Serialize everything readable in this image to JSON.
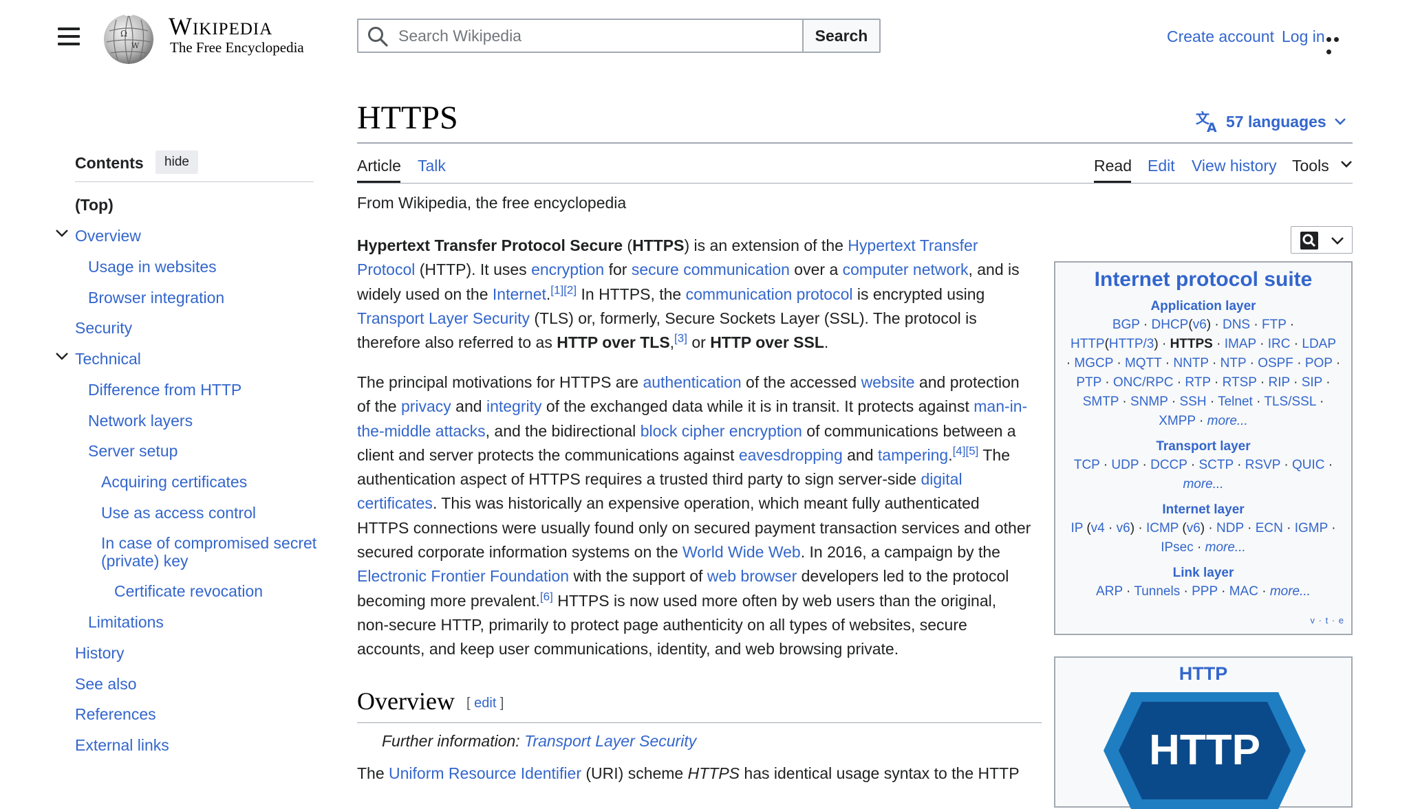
{
  "header": {
    "wordmark_title": "Wikipedia",
    "wordmark_tagline": "The Free Encyclopedia",
    "search_placeholder": "Search Wikipedia",
    "search_button": "Search",
    "create_account": "Create account",
    "log_in": "Log in"
  },
  "page": {
    "title": "HTTPS",
    "languages": "57 languages",
    "tabs_left": [
      "Article",
      "Talk"
    ],
    "tabs_right": [
      "Read",
      "Edit",
      "View history",
      "Tools"
    ],
    "from": "From Wikipedia, the free encyclopedia"
  },
  "toc": {
    "title": "Contents",
    "hide": "hide",
    "items": [
      {
        "label": "(Top)"
      },
      {
        "label": "Overview"
      },
      {
        "label": "Usage in websites"
      },
      {
        "label": "Browser integration"
      },
      {
        "label": "Security"
      },
      {
        "label": "Technical"
      },
      {
        "label": "Difference from HTTP"
      },
      {
        "label": "Network layers"
      },
      {
        "label": "Server setup"
      },
      {
        "label": "Acquiring certificates"
      },
      {
        "label": "Use as access control"
      },
      {
        "label": "In case of compromised secret"
      },
      {
        "label": "(private) key"
      },
      {
        "label": "Certificate revocation"
      },
      {
        "label": "Limitations"
      },
      {
        "label": "History"
      },
      {
        "label": "See also"
      },
      {
        "label": "References"
      },
      {
        "label": "External links"
      }
    ]
  },
  "article": {
    "p1": {
      "b1": "Hypertext Transfer Protocol Secure",
      "t1": " (",
      "b2": "HTTPS",
      "t2": ") is an extension of the ",
      "l1": "Hypertext Transfer Protocol",
      "t3": " (HTTP). It uses ",
      "l2": "encryption",
      "t4": " for ",
      "l3": "secure communication",
      "t5": " over a ",
      "l4": "computer network",
      "t6": ", and is widely used on the ",
      "l5": "Internet",
      "t7": ".",
      "r1": "[1]",
      "r2": "[2]",
      "t8": " In HTTPS, the ",
      "l6": "communication protocol",
      "t9": " is encrypted using ",
      "l7": "Transport Layer Security",
      "t10": " (TLS) or, formerly, Secure Sockets Layer (SSL). The protocol is therefore also referred to as ",
      "b3": "HTTP over TLS",
      "t11": ",",
      "r3": "[3]",
      "t12": " or ",
      "b4": "HTTP over SSL",
      "t13": "."
    },
    "p2": {
      "t1": "The principal motivations for HTTPS are ",
      "l1": "authentication",
      "t2": " of the accessed ",
      "l2": "website",
      "t3": " and protection of the ",
      "l3": "privacy",
      "t4": " and ",
      "l4": "integrity",
      "t5": " of the exchanged data while it is in transit. It protects against ",
      "l5": "man-in-the-middle attacks",
      "t6": ", and the bidirectional ",
      "l6": "block cipher encryption",
      "t7": " of communications between a client and server protects the communications against ",
      "l7": "eavesdropping",
      "t8": " and ",
      "l8": "tampering",
      "t9": ".",
      "r1": "[4]",
      "r2": "[5]",
      "t10": " The authentication aspect of HTTPS requires a trusted third party to sign server-side ",
      "l9": "digital certificates",
      "t11": ". This was historically an expensive operation, which meant fully authenticated HTTPS connections were usually found only on secured payment transaction services and other secured corporate information systems on the ",
      "l10": "World Wide Web",
      "t12": ". In 2016, a campaign by the ",
      "l11": "Electronic Frontier Foundation",
      "t13": " with the support of ",
      "l12": "web browser",
      "t14": " developers led to the protocol becoming more prevalent.",
      "r3": "[6]",
      "t15": " HTTPS is now used more often by web users than the original, non-secure HTTP, primarily to protect page authenticity on all types of websites, secure accounts, and keep user communications, identity, and web browsing private."
    },
    "overview_heading": "Overview",
    "edit_open": "[ ",
    "edit_label": "edit",
    "edit_close": " ]",
    "further_info_label": "Further information: ",
    "further_info_link": "Transport Layer Security",
    "p3": {
      "t1": "The ",
      "l1": "Uniform Resource Identifier",
      "t2": " (URI) scheme ",
      "i1": "HTTPS",
      "t3": " has identical usage syntax to the HTTP"
    }
  },
  "infobox": {
    "title": "Internet protocol suite",
    "app_layer": "Application layer",
    "app_items": [
      "BGP",
      "DHCP",
      "(",
      "v6",
      ")",
      "DNS",
      "FTP",
      "HTTP",
      "(",
      "HTTP/3",
      ")",
      "HTTPS",
      "IMAP",
      "IRC",
      "LDAP",
      "MGCP",
      "MQTT",
      "NNTP",
      "NTP",
      "OSPF",
      "POP",
      "PTP",
      "ONC/RPC",
      "RTP",
      "RTSP",
      "RIP",
      "SIP",
      "SMTP",
      "SNMP",
      "SSH",
      "Telnet",
      "TLS/SSL",
      "XMPP",
      "more..."
    ],
    "transport_layer": "Transport layer",
    "transport_items": [
      "TCP",
      "UDP",
      "DCCP",
      "SCTP",
      "RSVP",
      "QUIC",
      "more..."
    ],
    "internet_layer": "Internet layer",
    "internet_items": [
      "IP",
      "(",
      "v4",
      "v6",
      ")",
      "ICMP",
      "(",
      "v6",
      ")",
      "NDP",
      "ECN",
      "IGMP",
      "IPsec",
      "more..."
    ],
    "link_layer": "Link layer",
    "link_items": [
      "ARP",
      "Tunnels",
      "PPP",
      "MAC",
      "more..."
    ],
    "vte": "v · t · e"
  },
  "infobox2": {
    "title": "HTTP",
    "logo_text": "HTTP"
  },
  "colors": {
    "link": "#3366cc",
    "text": "#202122",
    "border": "#a2a9b1",
    "logo_outer": "#1f7ec2",
    "logo_inner": "#0b4a8a"
  }
}
